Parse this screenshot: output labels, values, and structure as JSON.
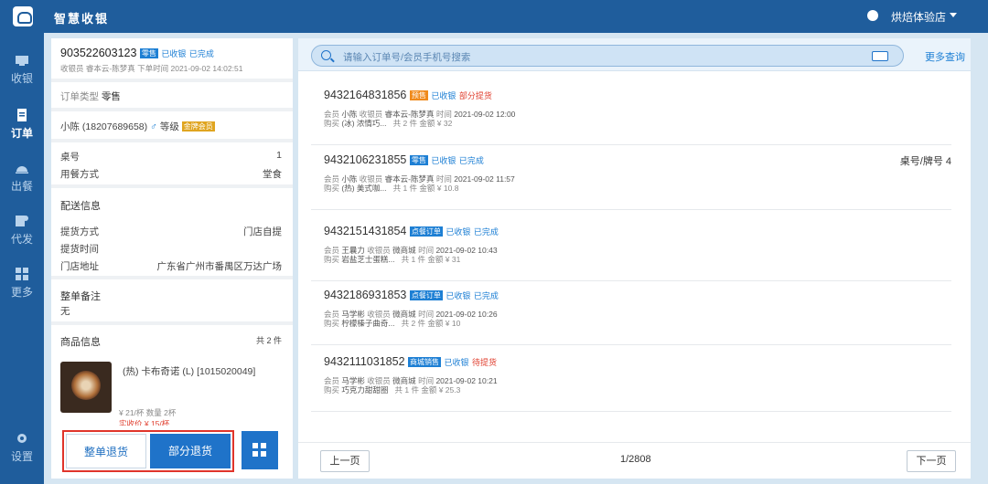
{
  "app": {
    "title": "智慧收银",
    "store": "烘焙体验店"
  },
  "sidebar": {
    "items": [
      {
        "label": "收银",
        "icon": "cashier-icon"
      },
      {
        "label": "订单",
        "icon": "order-icon"
      },
      {
        "label": "出餐",
        "icon": "serve-icon"
      },
      {
        "label": "代发",
        "icon": "delivery-icon"
      },
      {
        "label": "更多",
        "icon": "more-grid-icon"
      }
    ],
    "settings": "设置"
  },
  "detail": {
    "order_no": "903522603123",
    "order_tag": "零售",
    "status_paid": "已收银",
    "status_done": "已完成",
    "cashier_label": "收银员",
    "cashier": "睿本云-陈梦真",
    "time_label": "下单时间",
    "time": "2021-09-02 14:02:51",
    "type_label": "订单类型",
    "type_value": "零售",
    "member": "小陈 (18207689658)",
    "male_symbol": "♂",
    "level_label": "等级",
    "level_badge": "金牌会员",
    "table_label": "桌号",
    "table_value": "1",
    "dine_label": "用餐方式",
    "dine_value": "堂食",
    "delivery_title": "配送信息",
    "pickup_label": "提货方式",
    "pickup_value": "门店自提",
    "pickup_time_label": "提货时间",
    "address_label": "门店地址",
    "address_value": "广东省广州市番禺区万达广场",
    "remark_title": "整单备注",
    "remark_value": "无",
    "goods_title": "商品信息",
    "goods_count": "共 2 件",
    "item_name": "(热) 卡布奇诺 (L) [1015020049]",
    "item_price": "¥ 21/杯",
    "item_qty": "数量 2杯",
    "item_extra": "实收价 ¥ 15/杯"
  },
  "actions": {
    "whole_refund": "整单退货",
    "partial_refund": "部分退货"
  },
  "search": {
    "placeholder": "请输入订单号/会员手机号搜索",
    "more": "更多查询"
  },
  "orders": [
    {
      "no": "9432164831856",
      "tag": "预售",
      "tag_color": "#f08a1c",
      "s1": "已收银",
      "s2": "部分提货",
      "s2_color": "#e04030",
      "member": "小陈",
      "cashier": "睿本云-陈梦真",
      "time": "2021-09-02 12:00",
      "goods": "(冰) 浓情巧...",
      "count": "共 2 件",
      "amount": "金额 ¥ 32",
      "right": ""
    },
    {
      "no": "9432106231855",
      "tag": "零售",
      "tag_color": "#1d7fd4",
      "s1": "已收银",
      "s2": "已完成",
      "s2_color": "#1d7fd4",
      "member": "小陈",
      "cashier": "睿本云-陈梦真",
      "time": "2021-09-02 11:57",
      "goods": "(热) 美式咖...",
      "count": "共 1 件",
      "amount": "金额 ¥ 10.8",
      "right": "桌号/牌号 4"
    },
    {
      "no": "9432151431854",
      "tag": "点餐订单",
      "tag_color": "#1d7fd4",
      "s1": "已收银",
      "s2": "已完成",
      "s2_color": "#1d7fd4",
      "member": "王曩力",
      "cashier": "微商城",
      "time": "2021-09-02 10:43",
      "goods": "岩盐芝士蛋糕...",
      "count": "共 1 件",
      "amount": "金额 ¥ 31",
      "right": ""
    },
    {
      "no": "9432186931853",
      "tag": "点餐订单",
      "tag_color": "#1d7fd4",
      "s1": "已收银",
      "s2": "已完成",
      "s2_color": "#1d7fd4",
      "member": "马学彬",
      "cashier": "微商城",
      "time": "2021-09-02 10:26",
      "goods": "柠檬榛子曲奇...",
      "count": "共 2 件",
      "amount": "金额 ¥ 10",
      "right": ""
    },
    {
      "no": "9432111031852",
      "tag": "商城销售",
      "tag_color": "#1d7fd4",
      "s1": "已收银",
      "s2": "待提货",
      "s2_color": "#e04030",
      "member": "马学彬",
      "cashier": "微商城",
      "time": "2021-09-02 10:21",
      "goods": "巧克力甜甜圈",
      "count": "共 1 件",
      "amount": "金额 ¥ 25.3",
      "right": ""
    }
  ],
  "labels": {
    "member": "会员",
    "cashier": "收银员",
    "time": "时间",
    "buy": "购买"
  },
  "pager": {
    "prev": "上一页",
    "info": "1/2808",
    "next": "下一页"
  }
}
